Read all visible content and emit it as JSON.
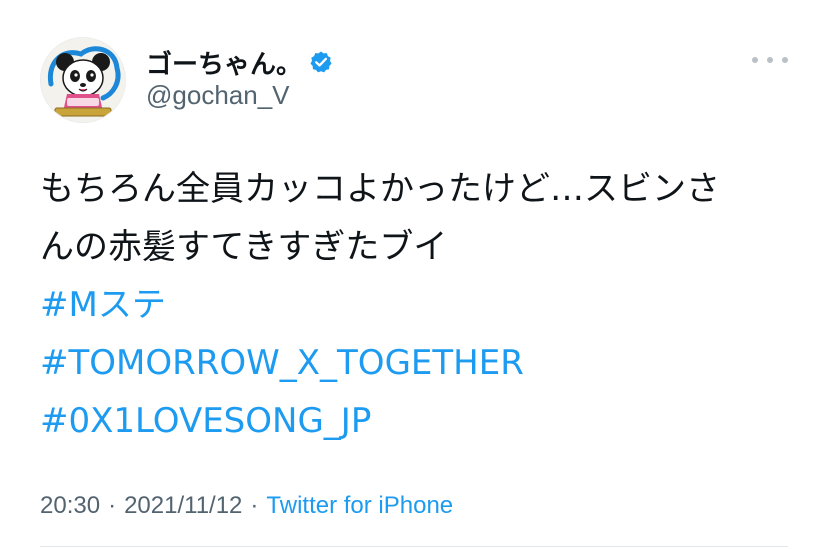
{
  "tweet": {
    "author": {
      "display_name": "ゴーちゃん。",
      "handle": "@gochan_V",
      "verified": true,
      "avatar_icon": "panda-mascot-avatar"
    },
    "text_lines": [
      "もちろん全員カッコよかったけど…スビンさ",
      "んの赤髪すてきすぎたブイ"
    ],
    "hashtags": [
      "#Mステ",
      "#TOMORROW_X_TOGETHER",
      "#0X1LOVESONG_JP"
    ],
    "time": "20:30",
    "separator": "·",
    "date": "2021/11/12",
    "source": "Twitter for iPhone",
    "more_icon": "more-horizontal-icon"
  },
  "colors": {
    "link": "#1d9bf0",
    "secondary_text": "#536471",
    "primary_text": "#0f1419",
    "verified_badge": "#1d9bf0"
  }
}
